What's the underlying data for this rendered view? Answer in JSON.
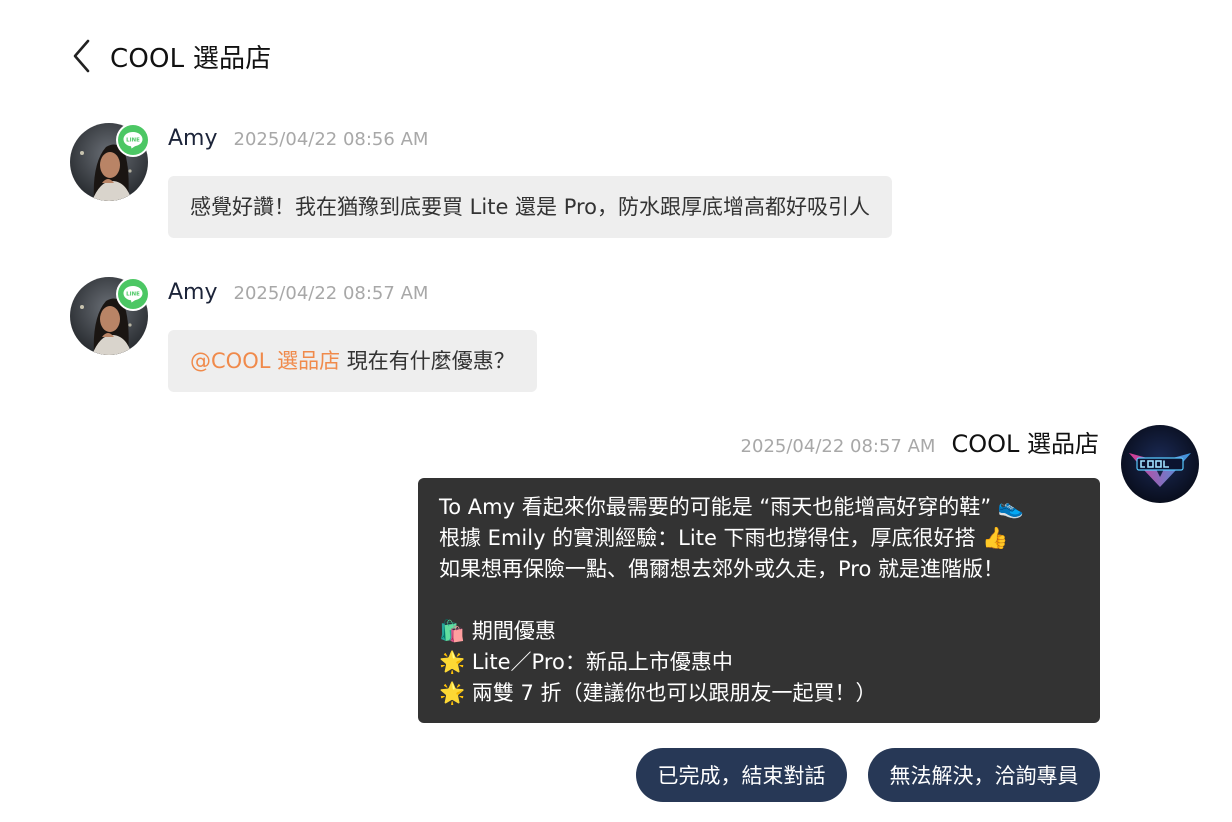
{
  "header": {
    "title": "COOL 選品店"
  },
  "messages": [
    {
      "sender": "Amy",
      "time": "2025/04/22 08:56 AM",
      "text": "感覺好讚！我在猶豫到底要買 Lite 還是 Pro，防水跟厚底增高都好吸引人"
    },
    {
      "sender": "Amy",
      "time": "2025/04/22 08:57 AM",
      "mention": "@COOL 選品店",
      "text": " 現在有什麼優惠？"
    }
  ],
  "reply": {
    "sender": "COOL 選品店",
    "time": "2025/04/22 08:57 AM",
    "lines": [
      "To Amy 看起來你最需要的可能是 “雨天也能增高好穿的鞋”",
      "根據 Emily 的實測經驗：Lite 下雨也撐得住，厚底很好搭",
      "如果想再保險一點、偶爾想去郊外或久走，Pro 就是進階版！",
      "",
      "期間優惠",
      "Lite／Pro：新品上市優惠中",
      "兩雙 7 折（建議你也可以跟朋友一起買！）"
    ],
    "emoji": [
      "👟",
      "👍",
      "🛍️",
      "🌟",
      "🌟"
    ]
  },
  "actions": {
    "done_label": "已完成，結束對話",
    "contact_label": "無法解決，洽詢專員"
  },
  "badge": {
    "line_text": "LINE",
    "line_color": "#4cc764"
  },
  "colors": {
    "accent_button": "#273856",
    "bot_bubble": "#333333",
    "user_bubble": "#eeeeee",
    "mention": "#f08a4b"
  }
}
